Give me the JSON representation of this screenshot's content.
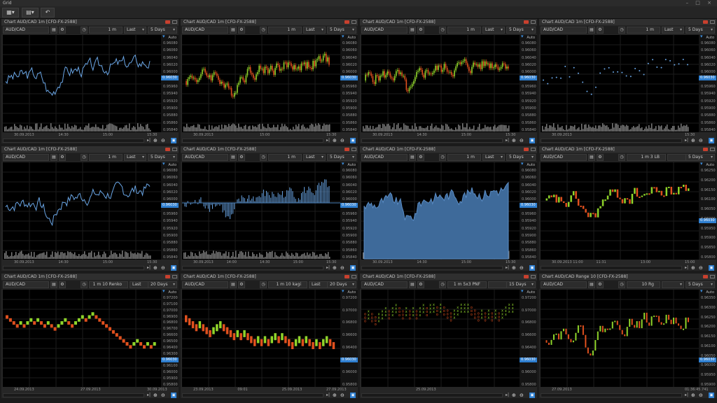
{
  "window": {
    "title": "Grid",
    "controls": "– □ ×"
  },
  "toolbar": {
    "layout_icon": "grid-layout-icon",
    "template_icon": "template-icon",
    "undo_icon": "undo-icon"
  },
  "colors": {
    "accent": "#2f7fd0",
    "bull": "#8fd42a",
    "bear": "#e0501e",
    "line": "#6aa6e6",
    "area": "#3e6a9a",
    "volume": "#7a7a7a"
  },
  "panels": [
    {
      "title": "Chart AUD/CAD 1m [CFD-FX-2588]",
      "symbol": "AUD/CAD",
      "timeframe": "1 m",
      "price_type": "Last",
      "range": "5 Days",
      "chart_type": "line",
      "auto": "Auto",
      "price_tag": "0.96030",
      "y_ticks": [
        "0.96080",
        "0.96060",
        "0.96040",
        "0.96020",
        "0.96000",
        "0.95980",
        "0.95960",
        "0.95940",
        "0.95920",
        "0.95900",
        "0.95880",
        "0.95860",
        "0.95840"
      ],
      "x_labels": [
        "30.09.2013",
        "14:30",
        "15:00",
        "15:30"
      ]
    },
    {
      "title": "Chart AUD/CAD 1m [CFD-FX-2588]",
      "symbol": "AUD/CAD",
      "timeframe": "1 m",
      "price_type": "Last",
      "range": "5 Days",
      "chart_type": "bar",
      "auto": "Auto",
      "price_tag": "0.96030",
      "y_ticks": [
        "0.96080",
        "0.96060",
        "0.96040",
        "0.96020",
        "0.96000",
        "0.95980",
        "0.95960",
        "0.95940",
        "0.95920",
        "0.95900",
        "0.95880",
        "0.95860",
        "0.95840"
      ],
      "x_labels": [
        "30.09.2013",
        "15:00",
        "15:30"
      ]
    },
    {
      "title": "Chart AUD/CAD 1m [CFD-FX-2588]",
      "symbol": "AUD/CAD",
      "timeframe": "1 m",
      "price_type": "Last",
      "range": "5 Days",
      "chart_type": "candle",
      "auto": "Auto",
      "price_tag": "0.96030",
      "y_ticks": [
        "0.96080",
        "0.96060",
        "0.96040",
        "0.96020",
        "0.96000",
        "0.95980",
        "0.95960",
        "0.95940",
        "0.95920",
        "0.95900",
        "0.95880",
        "0.95860",
        "0.95840"
      ],
      "x_labels": [
        "30.09.2013",
        "14:30",
        "15:00",
        "15:30"
      ]
    },
    {
      "title": "Chart AUD/CAD 1m [CFD-FX-2588]",
      "symbol": "AUD/CAD",
      "timeframe": "1 m",
      "price_type": "Last",
      "range": "5 Days",
      "chart_type": "dots",
      "auto": "Auto",
      "price_tag": "0.96030",
      "y_ticks": [
        "0.96080",
        "0.96060",
        "0.96040",
        "0.96020",
        "0.96000",
        "0.95980",
        "0.95960",
        "0.95940",
        "0.95920",
        "0.95900",
        "0.95880",
        "0.95860",
        "0.95840"
      ],
      "x_labels": [
        "30.09.2013",
        "15:30"
      ]
    },
    {
      "title": "Chart AUD/CAD 1m [CFD-FX-2588]",
      "symbol": "AUD/CAD",
      "timeframe": "1 m",
      "price_type": "Last",
      "range": "5 Days",
      "chart_type": "line",
      "auto": "Auto",
      "price_tag": "0.96030",
      "y_ticks": [
        "0.96080",
        "0.96060",
        "0.96040",
        "0.96020",
        "0.96000",
        "0.95980",
        "0.95960",
        "0.95940",
        "0.95920",
        "0.95900",
        "0.95880",
        "0.95860",
        "0.95840"
      ],
      "x_labels": [
        "30.09.2013",
        "14:30",
        "15:00",
        "15:30"
      ]
    },
    {
      "title": "Chart AUD/CAD 1m [CFD-FX-2588]",
      "symbol": "AUD/CAD",
      "timeframe": "1 m",
      "price_type": "Last",
      "range": "5 Days",
      "chart_type": "histogram",
      "auto": "Auto",
      "price_tag": "0.96030",
      "y_ticks": [
        "0.96080",
        "0.96060",
        "0.96040",
        "0.96020",
        "0.96000",
        "0.95980",
        "0.95960",
        "0.95940",
        "0.95920",
        "0.95900",
        "0.95880",
        "0.95860",
        "0.95840"
      ],
      "x_labels": [
        "30.09.2013",
        "14:00",
        "14:30",
        "15:00",
        "15:30"
      ]
    },
    {
      "title": "Chart AUD/CAD 1m [CFD-FX-2588]",
      "symbol": "AUD/CAD",
      "timeframe": "1 m",
      "price_type": "Last",
      "range": "5 Days",
      "chart_type": "area",
      "auto": "Auto",
      "price_tag": "0.96030",
      "y_ticks": [
        "0.96080",
        "0.96060",
        "0.96040",
        "0.96020",
        "0.96000",
        "0.95980",
        "0.95960",
        "0.95940",
        "0.95920",
        "0.95900",
        "0.95880",
        "0.95860",
        "0.95840"
      ],
      "x_labels": [
        "30.09.2013",
        "14:30",
        "15:00",
        "15:30"
      ]
    },
    {
      "title": "Chart AUD/CAD 1m [CFD-FX-2588]",
      "symbol": "AUD/CAD",
      "timeframe": "1 m 3 LB",
      "price_type": "",
      "range": "5 Days",
      "chart_type": "linebreak",
      "auto": "Auto",
      "price_tag": "0.96030",
      "y_ticks": [
        "0.96250",
        "0.96200",
        "0.96150",
        "0.96100",
        "0.96050",
        "0.96000",
        "0.95950",
        "0.95900",
        "0.95850",
        "0.95800"
      ],
      "x_labels": [
        "30.09.2013 11:00",
        "11:31",
        "13:00",
        "15:00"
      ]
    },
    {
      "title": "Chart AUD/CAD 1m [CFD-FX-2588]",
      "symbol": "AUD/CAD",
      "timeframe": "1 m 10 Renko",
      "price_type": "Last",
      "range": "20 Days",
      "chart_type": "renko",
      "auto": "Auto",
      "price_tag": "0.96030",
      "y_ticks": [
        "0.97200",
        "0.97100",
        "0.97000",
        "0.96900",
        "0.96800",
        "0.96700",
        "0.96600",
        "0.96500",
        "0.96400",
        "0.96300",
        "0.96200",
        "0.96100",
        "0.96000",
        "0.95900",
        "0.95800"
      ],
      "x_labels": [
        "24.09.2013",
        "27.09.2013",
        "30.09.2013"
      ]
    },
    {
      "title": "Chart AUD/CAD 1m [CFD-FX-2588]",
      "symbol": "AUD/CAD",
      "timeframe": "1 m 10 kagi",
      "price_type": "Last",
      "range": "20 Days",
      "chart_type": "kagi",
      "auto": "Auto",
      "price_tag": "0.96030",
      "y_ticks": [
        "0.97200",
        "0.97000",
        "0.96800",
        "0.96600",
        "0.96400",
        "0.96200",
        "0.96000",
        "0.95800"
      ],
      "x_labels": [
        "23.09.2013",
        "09:01",
        "25.09.2013",
        "27.09.2013"
      ]
    },
    {
      "title": "Chart AUD/CAD 1m [CFD-FX-2588]",
      "symbol": "AUD/CAD",
      "timeframe": "1 m 5x3 PNF",
      "price_type": "",
      "range": "15 Days",
      "chart_type": "pnf",
      "auto": "Auto",
      "price_tag": "0.96030",
      "y_ticks": [
        "0.97200",
        "0.97000",
        "0.96800",
        "0.96600",
        "0.96400",
        "0.96200",
        "0.96000",
        "0.95800"
      ],
      "x_labels": [
        "25.09.2013"
      ]
    },
    {
      "title": "Chart AUD/CAD Range 10 [CFD-FX-2588]",
      "symbol": "AUD/CAD",
      "timeframe": "10 Rg",
      "price_type": "",
      "range": "5 Days",
      "chart_type": "range",
      "auto": "Auto",
      "price_tag": "0.96030",
      "y_ticks": [
        "0.96350",
        "0.96300",
        "0.96250",
        "0.96200",
        "0.96150",
        "0.96100",
        "0.96050",
        "0.96000",
        "0.95950",
        "0.95900"
      ],
      "x_labels": [
        "27.09.2013",
        "01:36:45.741"
      ]
    }
  ]
}
